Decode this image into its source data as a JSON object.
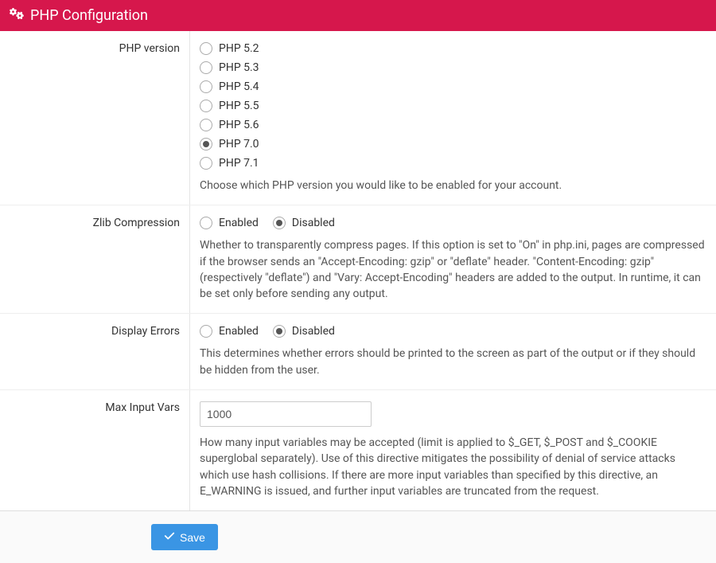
{
  "panel": {
    "title": "PHP Configuration"
  },
  "php_version": {
    "label": "PHP version",
    "options": [
      {
        "label": "PHP 5.2",
        "checked": false
      },
      {
        "label": "PHP 5.3",
        "checked": false
      },
      {
        "label": "PHP 5.4",
        "checked": false
      },
      {
        "label": "PHP 5.5",
        "checked": false
      },
      {
        "label": "PHP 5.6",
        "checked": false
      },
      {
        "label": "PHP 7.0",
        "checked": true
      },
      {
        "label": "PHP 7.1",
        "checked": false
      }
    ],
    "help": "Choose which PHP version you would like to be enabled for your account."
  },
  "zlib": {
    "label": "Zlib Compression",
    "enabled_label": "Enabled",
    "disabled_label": "Disabled",
    "enabled_checked": false,
    "disabled_checked": true,
    "help": "Whether to transparently compress pages. If this option is set to \"On\" in php.ini, pages are compressed if the browser sends an \"Accept-Encoding: gzip\" or \"deflate\" header. \"Content-Encoding: gzip\" (respectively \"deflate\") and \"Vary: Accept-Encoding\" headers are added to the output. In runtime, it can be set only before sending any output."
  },
  "display_errors": {
    "label": "Display Errors",
    "enabled_label": "Enabled",
    "disabled_label": "Disabled",
    "enabled_checked": false,
    "disabled_checked": true,
    "help": "This determines whether errors should be printed to the screen as part of the output or if they should be hidden from the user."
  },
  "max_input_vars": {
    "label": "Max Input Vars",
    "value": "1000",
    "help": "How many input variables may be accepted (limit is applied to $_GET, $_POST and $_COOKIE superglobal separately). Use of this directive mitigates the possibility of denial of service attacks which use hash collisions. If there are more input variables than specified by this directive, an E_WARNING is issued, and further input variables are truncated from the request."
  },
  "footer": {
    "save_label": "Save"
  }
}
